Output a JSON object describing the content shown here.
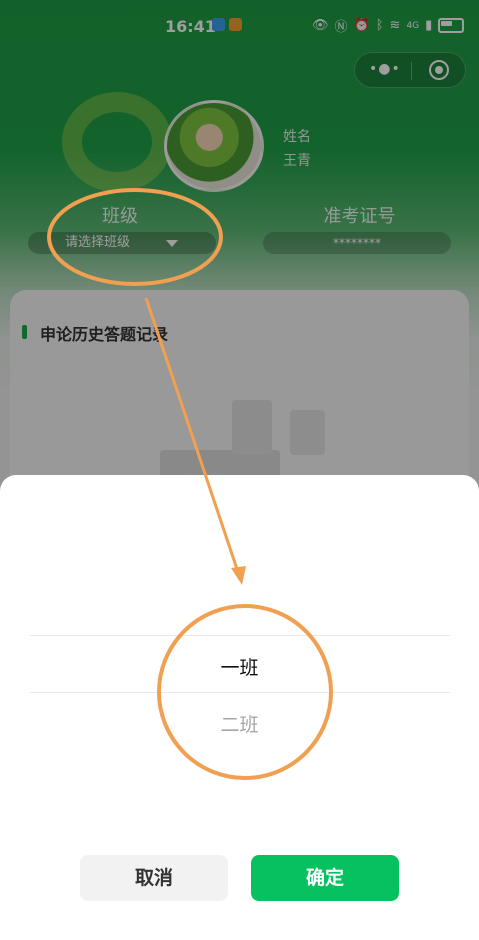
{
  "status_bar": {
    "time": "16:41",
    "network": "4G"
  },
  "capsule": {
    "more_glyph": "•●•"
  },
  "profile": {
    "name_label": "姓名",
    "name_value": "王青",
    "class_label": "班级",
    "class_placeholder": "请选择班级",
    "exam_no_label": "准考证号",
    "exam_no_value": "********"
  },
  "card": {
    "title": "申论历史答题记录"
  },
  "picker": {
    "options": [
      {
        "label": "一班",
        "state": "selected"
      },
      {
        "label": "二班",
        "state": "unselected"
      }
    ]
  },
  "buttons": {
    "cancel": "取消",
    "confirm": "确定"
  },
  "colors": {
    "brand_green": "#1f9d45",
    "confirm_green": "#06c160",
    "annotation_orange": "#f0a050"
  }
}
